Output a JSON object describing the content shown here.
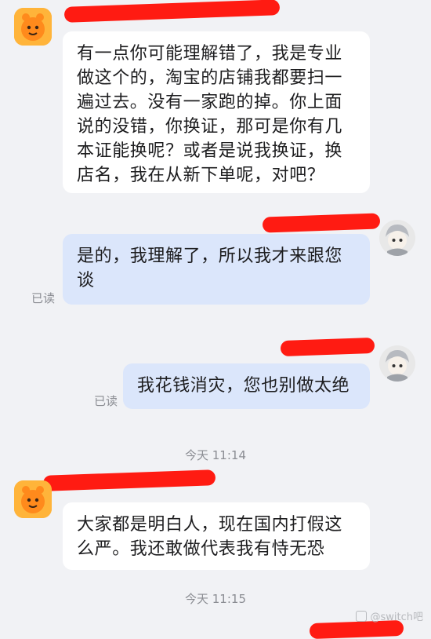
{
  "messages": [
    {
      "sender": "other",
      "text": "有一点你可能理解错了，我是专业做这个的，淘宝的店铺我都要扫一遍过去。没有一家跑的掉。你上面说的没错，你换证，那可是你有几本证能换呢？或者是说我换证，换店名，我在从新下单呢，对吧？"
    },
    {
      "sender": "me",
      "text": "是的，我理解了，所以我才来跟您谈",
      "status": "已读"
    },
    {
      "sender": "me",
      "text": "我花钱消灾，您也别做太绝",
      "status": "已读"
    },
    {
      "time": "今天 11:14"
    },
    {
      "sender": "other",
      "text": "大家都是明白人，现在国内打假这么严。我还敢做代表我有恃无恐"
    },
    {
      "time": "今天 11:15"
    }
  ],
  "watermark": {
    "text": "@switch吧"
  },
  "colors": {
    "background": "#f1f2f5",
    "bubble_other": "#ffffff",
    "bubble_me": "#dbe6fb",
    "redaction": "#ff1b12"
  },
  "icons": {
    "other_avatar": "orange-mascot-avatar",
    "my_avatar": "grey-cartoon-avatar"
  }
}
